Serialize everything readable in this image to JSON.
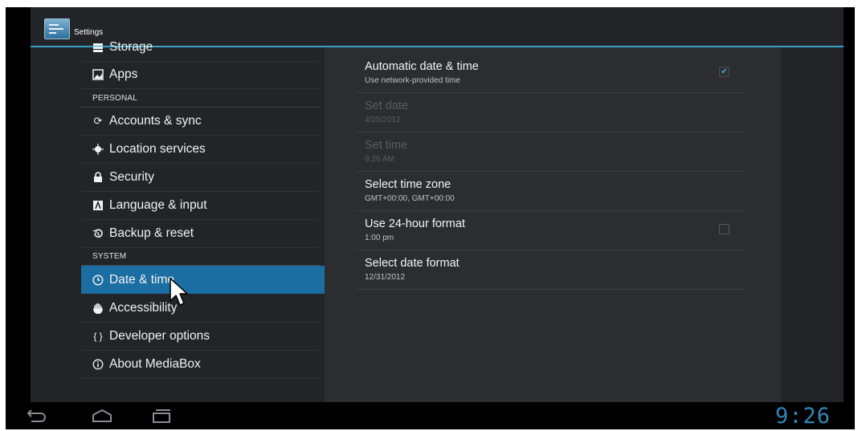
{
  "actionbar": {
    "title": "Settings"
  },
  "sidebar": {
    "items_top": [
      {
        "label": "Storage",
        "icon": "storage-icon"
      },
      {
        "label": "Apps",
        "icon": "apps-icon"
      }
    ],
    "personal_header": "PERSONAL",
    "personal_items": [
      {
        "label": "Accounts & sync",
        "icon": "sync-icon"
      },
      {
        "label": "Location services",
        "icon": "location-icon"
      },
      {
        "label": "Security",
        "icon": "lock-icon"
      },
      {
        "label": "Language & input",
        "icon": "keyboard-icon"
      },
      {
        "label": "Backup & reset",
        "icon": "backup-icon"
      }
    ],
    "system_header": "SYSTEM",
    "system_items": [
      {
        "label": "Date & time",
        "icon": "clock-icon",
        "selected": true
      },
      {
        "label": "Accessibility",
        "icon": "hand-icon"
      },
      {
        "label": "Developer options",
        "icon": "braces-icon"
      },
      {
        "label": "About MediaBox",
        "icon": "info-icon"
      }
    ]
  },
  "detail": {
    "prefs": [
      {
        "title": "Automatic date & time",
        "summary": "Use network-provided time",
        "checkbox": "checked"
      },
      {
        "title": "Set date",
        "summary": "4/25/2012",
        "disabled": true
      },
      {
        "title": "Set time",
        "summary": "9:26 AM",
        "disabled": true
      },
      {
        "title": "Select time zone",
        "summary": "GMT+00:00, GMT+00:00"
      },
      {
        "title": "Use 24-hour format",
        "summary": "1:00 pm",
        "checkbox": "unchecked"
      },
      {
        "title": "Select date format",
        "summary": "12/31/2012"
      }
    ]
  },
  "statusbar": {
    "clock": "9:26"
  },
  "colors": {
    "accent": "#36a2c9",
    "selected": "#1b6ea1",
    "clock": "#2f87b6"
  }
}
